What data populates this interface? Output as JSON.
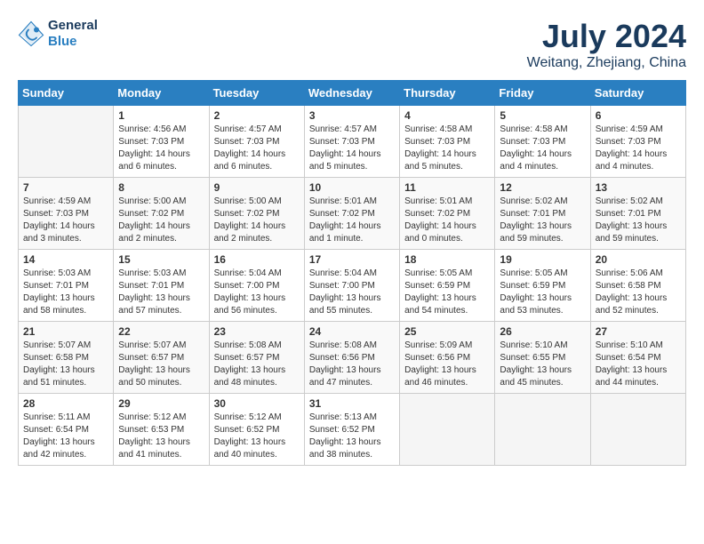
{
  "header": {
    "logo_line1": "General",
    "logo_line2": "Blue",
    "month": "July 2024",
    "location": "Weitang, Zhejiang, China"
  },
  "columns": [
    "Sunday",
    "Monday",
    "Tuesday",
    "Wednesday",
    "Thursday",
    "Friday",
    "Saturday"
  ],
  "weeks": [
    [
      {
        "day": "",
        "text": ""
      },
      {
        "day": "1",
        "text": "Sunrise: 4:56 AM\nSunset: 7:03 PM\nDaylight: 14 hours\nand 6 minutes."
      },
      {
        "day": "2",
        "text": "Sunrise: 4:57 AM\nSunset: 7:03 PM\nDaylight: 14 hours\nand 6 minutes."
      },
      {
        "day": "3",
        "text": "Sunrise: 4:57 AM\nSunset: 7:03 PM\nDaylight: 14 hours\nand 5 minutes."
      },
      {
        "day": "4",
        "text": "Sunrise: 4:58 AM\nSunset: 7:03 PM\nDaylight: 14 hours\nand 5 minutes."
      },
      {
        "day": "5",
        "text": "Sunrise: 4:58 AM\nSunset: 7:03 PM\nDaylight: 14 hours\nand 4 minutes."
      },
      {
        "day": "6",
        "text": "Sunrise: 4:59 AM\nSunset: 7:03 PM\nDaylight: 14 hours\nand 4 minutes."
      }
    ],
    [
      {
        "day": "7",
        "text": "Sunrise: 4:59 AM\nSunset: 7:03 PM\nDaylight: 14 hours\nand 3 minutes."
      },
      {
        "day": "8",
        "text": "Sunrise: 5:00 AM\nSunset: 7:02 PM\nDaylight: 14 hours\nand 2 minutes."
      },
      {
        "day": "9",
        "text": "Sunrise: 5:00 AM\nSunset: 7:02 PM\nDaylight: 14 hours\nand 2 minutes."
      },
      {
        "day": "10",
        "text": "Sunrise: 5:01 AM\nSunset: 7:02 PM\nDaylight: 14 hours\nand 1 minute."
      },
      {
        "day": "11",
        "text": "Sunrise: 5:01 AM\nSunset: 7:02 PM\nDaylight: 14 hours\nand 0 minutes."
      },
      {
        "day": "12",
        "text": "Sunrise: 5:02 AM\nSunset: 7:01 PM\nDaylight: 13 hours\nand 59 minutes."
      },
      {
        "day": "13",
        "text": "Sunrise: 5:02 AM\nSunset: 7:01 PM\nDaylight: 13 hours\nand 59 minutes."
      }
    ],
    [
      {
        "day": "14",
        "text": "Sunrise: 5:03 AM\nSunset: 7:01 PM\nDaylight: 13 hours\nand 58 minutes."
      },
      {
        "day": "15",
        "text": "Sunrise: 5:03 AM\nSunset: 7:01 PM\nDaylight: 13 hours\nand 57 minutes."
      },
      {
        "day": "16",
        "text": "Sunrise: 5:04 AM\nSunset: 7:00 PM\nDaylight: 13 hours\nand 56 minutes."
      },
      {
        "day": "17",
        "text": "Sunrise: 5:04 AM\nSunset: 7:00 PM\nDaylight: 13 hours\nand 55 minutes."
      },
      {
        "day": "18",
        "text": "Sunrise: 5:05 AM\nSunset: 6:59 PM\nDaylight: 13 hours\nand 54 minutes."
      },
      {
        "day": "19",
        "text": "Sunrise: 5:05 AM\nSunset: 6:59 PM\nDaylight: 13 hours\nand 53 minutes."
      },
      {
        "day": "20",
        "text": "Sunrise: 5:06 AM\nSunset: 6:58 PM\nDaylight: 13 hours\nand 52 minutes."
      }
    ],
    [
      {
        "day": "21",
        "text": "Sunrise: 5:07 AM\nSunset: 6:58 PM\nDaylight: 13 hours\nand 51 minutes."
      },
      {
        "day": "22",
        "text": "Sunrise: 5:07 AM\nSunset: 6:57 PM\nDaylight: 13 hours\nand 50 minutes."
      },
      {
        "day": "23",
        "text": "Sunrise: 5:08 AM\nSunset: 6:57 PM\nDaylight: 13 hours\nand 48 minutes."
      },
      {
        "day": "24",
        "text": "Sunrise: 5:08 AM\nSunset: 6:56 PM\nDaylight: 13 hours\nand 47 minutes."
      },
      {
        "day": "25",
        "text": "Sunrise: 5:09 AM\nSunset: 6:56 PM\nDaylight: 13 hours\nand 46 minutes."
      },
      {
        "day": "26",
        "text": "Sunrise: 5:10 AM\nSunset: 6:55 PM\nDaylight: 13 hours\nand 45 minutes."
      },
      {
        "day": "27",
        "text": "Sunrise: 5:10 AM\nSunset: 6:54 PM\nDaylight: 13 hours\nand 44 minutes."
      }
    ],
    [
      {
        "day": "28",
        "text": "Sunrise: 5:11 AM\nSunset: 6:54 PM\nDaylight: 13 hours\nand 42 minutes."
      },
      {
        "day": "29",
        "text": "Sunrise: 5:12 AM\nSunset: 6:53 PM\nDaylight: 13 hours\nand 41 minutes."
      },
      {
        "day": "30",
        "text": "Sunrise: 5:12 AM\nSunset: 6:52 PM\nDaylight: 13 hours\nand 40 minutes."
      },
      {
        "day": "31",
        "text": "Sunrise: 5:13 AM\nSunset: 6:52 PM\nDaylight: 13 hours\nand 38 minutes."
      },
      {
        "day": "",
        "text": ""
      },
      {
        "day": "",
        "text": ""
      },
      {
        "day": "",
        "text": ""
      }
    ]
  ]
}
